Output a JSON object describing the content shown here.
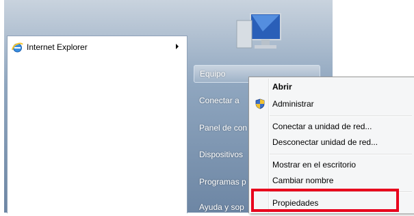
{
  "start_menu": {
    "programs": [
      {
        "label": "Internet Explorer",
        "icon": "internet-explorer-icon",
        "has_submenu": true
      }
    ],
    "right_items": [
      {
        "label": "Equipo",
        "selected": true
      },
      {
        "label": "Conectar a"
      },
      {
        "label": "Panel de con"
      },
      {
        "label": "Dispositivos"
      },
      {
        "label": "Programas p"
      },
      {
        "label": "Ayuda y sop"
      }
    ]
  },
  "context_menu": {
    "items": [
      {
        "label": "Abrir",
        "bold": true
      },
      {
        "label": "Administrar",
        "icon": "shield-icon"
      },
      {
        "label": "Conectar a unidad de red..."
      },
      {
        "label": "Desconectar unidad de red..."
      },
      {
        "label": "Mostrar en el escritorio"
      },
      {
        "label": "Cambiar nombre"
      },
      {
        "label": "Propiedades",
        "highlighted": true
      }
    ]
  },
  "colors": {
    "highlight_border": "#e8001c",
    "menu_background": "#f5f6f7"
  }
}
